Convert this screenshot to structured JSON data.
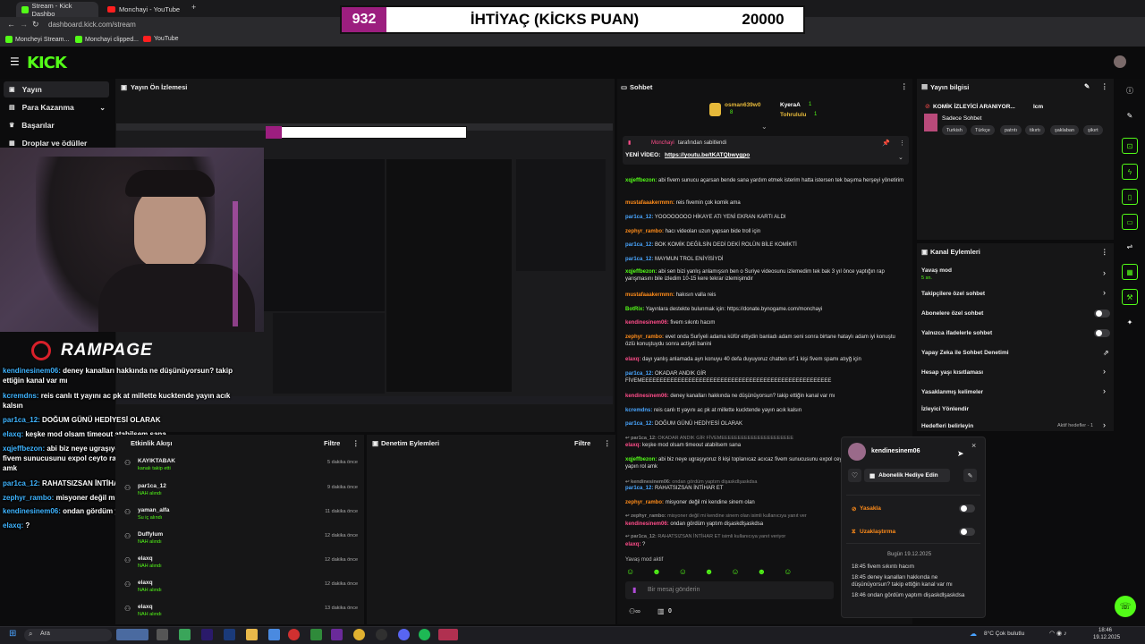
{
  "browser": {
    "tabs": [
      {
        "label": "Stream - Kick Dashbo"
      },
      {
        "label": "Monchayi - YouTube"
      }
    ],
    "url": "dashboard.kick.com/stream",
    "bookmarks": [
      {
        "label": "Moncheyi Stream..."
      },
      {
        "label": "Monchayi clipped..."
      },
      {
        "label": "YouTube"
      }
    ]
  },
  "overlay": {
    "count": "932",
    "title": "İHTİYAÇ (KİCKS PUAN)",
    "goal": "20000"
  },
  "sidebar": {
    "items": [
      {
        "label": "Yayın"
      },
      {
        "label": "Para Kazanma"
      },
      {
        "label": "Başarılar"
      },
      {
        "label": "Droplar ve ödüller"
      }
    ]
  },
  "preview": {
    "title": "Yayın Ön İzlemesi",
    "logo_text": "RAMPAGE"
  },
  "stream_chat_overlay": [
    {
      "user": "kendinesinem06:",
      "text": " deney kanalları hakkında ne düşünüyorsun? takip ettiğin kanal var mı"
    },
    {
      "user": "kcremdns:",
      "text": " reis canlı tt yayını ac pk at millette kucktende yayın acık kalsın"
    },
    {
      "user": "par1ca_12:",
      "text": " DOĞUM GÜNÜ HEDİYESİ OLARAK"
    },
    {
      "user": "elaxq:",
      "text": " keşke mod olsam timeout atabilsem sana"
    },
    {
      "user": "xqjeffbezon:",
      "text": " abi biz neye ugraşıyoruz 8 kişi toplanıcaz acıcaz fivem sunucusunu expol ceyto raconsal alıcaz hepsini yapın rol amk"
    },
    {
      "user": "par1ca_12:",
      "text": " RAHATSIZSAN İNTİHAR ET"
    },
    {
      "user": "zephyr_rambo:",
      "text": " misyoner değil mi kendine sinem olan"
    },
    {
      "user": "kendinesinem06:",
      "text": " ondan gördüm yaptım dişaskdlşaskdsa"
    },
    {
      "user": "elaxq:",
      "text": " ?"
    }
  ],
  "chat": {
    "title": "Sohbet",
    "top_gifters": [
      {
        "name": "osman639w0",
        "count": "8"
      },
      {
        "name": "KyeraA",
        "count": "1"
      },
      {
        "name": "Tohrululu",
        "count": "1"
      }
    ],
    "pinned": {
      "user": "Monchayi",
      "suffix": "tarafından sabitlendi",
      "label": "YENİ VİDEO:",
      "link": "https://youtu.be/tKATQbwygpo"
    },
    "messages": [
      {
        "user": "xqjeffbezon:",
        "text": "abi fivem sunucu açarsan bende sana yardım etmek isterim hatta istersen tek başıma herşeyi yönetirim",
        "color": "green"
      },
      {
        "user": "mustafaaakermmn:",
        "text": "reis fivemin çok komik ama",
        "color": "orange"
      },
      {
        "user": "par1ca_12:",
        "text": "YOOOOOOOO HİKAYE ATI YENİ EKRAN KARTI ALDI",
        "color": "blue"
      },
      {
        "user": "zephyr_rambo:",
        "text": "hacı videoları uzun yapsan bide troll için",
        "color": "orange"
      },
      {
        "user": "par1ca_12:",
        "text": "BOK KOMİK DEĞİLSİN DEDİ DEKİ ROLÜN BİLE KOMİKTİ",
        "color": "blue"
      },
      {
        "user": "par1ca_12:",
        "text": "MAYMUN TROL ENİYİSİYDİ",
        "color": "blue"
      },
      {
        "user": "xqjeffbezon:",
        "text": "abi sen bizi yanlış anlamışsın ben o Suriye videosunu izlemedim tek bak 3 yıl önce yaptığın rap yarışmasını bile izledim 10-15 kere tekrar izlemişimdir",
        "color": "green"
      },
      {
        "user": "mustafaaakermmn:",
        "text": "hakısın valla reis",
        "color": "orange"
      },
      {
        "user": "BotRix:",
        "text": "Yayınlara destekte bulunmak için: https://donate.bynogame.com/monchayi",
        "color": "green"
      },
      {
        "user": "kendinesinem06:",
        "text": "fivem sıkıntı hacım",
        "color": "pink"
      },
      {
        "user": "zephyr_rambo:",
        "text": "evet onda Surİyeli adama küfür ettiydin banladı adam seni sonra birtane hataylı adam iyi konuştu özlü konuştuydu sonra actiydi banini",
        "color": "orange"
      },
      {
        "user": "elaxq:",
        "text": "dayı yanlış anlamada ayrı konuyu 40 defa duyuyoruz chatten srf 1 kişi fivem spamı atıyğ için",
        "color": "pink"
      },
      {
        "user": "par1ca_12:",
        "text": "OKADAR ANDIK GİR FİVEMEEEEEEEEEEEEEEEEEEEEEEEEEEEEEEEEEEEEEEEEEEEEEEEEEEEEE",
        "color": "blue"
      },
      {
        "user": "kendinesinem06:",
        "text": "deney kanalları hakkında ne düşünüyorsun? takip ettiğin kanal var mı",
        "color": "pink"
      },
      {
        "user": "kcremdns:",
        "text": "reis canlı tt yayını ac pk at millette kucktende yayın acık kalsın",
        "color": "blue"
      },
      {
        "user": "par1ca_12:",
        "text": "DOĞUM GÜNÜ HEDİYESİ OLARAK",
        "color": "blue"
      },
      {
        "user": "↩ par1ca_12:",
        "text": "OKADAR ANDIK GİR FİVEMEEEEEEEEEEEEEEEEEEEEEE",
        "color": "grey"
      },
      {
        "user": "elaxq:",
        "text": "keşke mod olsam timeout atabilsem sana",
        "color": "pink"
      },
      {
        "user": "xqjeffbezon:",
        "text": "abi biz neye ugraşıyoruz 8 kişi toplanıcaz acıcaz fivem sunucusunu expol ceyto raconsal alıcaz hepsini yapın rol amk",
        "color": "green"
      },
      {
        "user": "↩ kendinesinem06:",
        "text": "ondan gördüm yaptım dişaskdlşaskdsa",
        "color": "grey"
      },
      {
        "user": "par1ca_12:",
        "text": "RAHATSIZSAN İNTİHAR ET",
        "color": "blue"
      },
      {
        "user": "zephyr_rambo:",
        "text": "misyoner değil mi kendine sinem olan",
        "color": "orange"
      },
      {
        "user": "↩ zephyr_rambo:",
        "text": "misyoner değil mi kendine sinem olan isimli kullanıcıya yanıt ver",
        "color": "grey"
      },
      {
        "user": "kendinesinem06:",
        "text": "ondan gördüm yaptım dişaskdlşaskdsa",
        "color": "pink"
      },
      {
        "user": "↩ par1ca_12:",
        "text": "RAHATSIZSAN İNTİHAR ET isimli kullanıcıya yanıt veriyor",
        "color": "grey"
      },
      {
        "user": "elaxq:",
        "text": "?",
        "color": "pink"
      }
    ],
    "slow_mode": "Yavaş mod aktif",
    "input_placeholder": "Bir mesaj gönderin",
    "footer_count": "0"
  },
  "stream_info": {
    "title": "Yayın bilgisi",
    "stream_title": "KOMİK İZLEYİCİ ARANIYOR...",
    "stream_title_suffix": "lcm",
    "category": "Sadece Sohbet",
    "tags": [
      "Turkish",
      "Türkçe",
      "patrıtı",
      "tikırtı",
      "şaklaban",
      "şikırt"
    ]
  },
  "channel_actions": {
    "title": "Kanal Eylemleri",
    "items": [
      {
        "label": "Yavaş mod",
        "sub": "5 sn."
      },
      {
        "label": "Takipçilere özel sohbet"
      },
      {
        "label": "Abonelere özel sohbet"
      },
      {
        "label": "Yalnızca ifadelerle sohbet"
      },
      {
        "label": "Yapay Zeka ile Sohbet Denetimi"
      },
      {
        "label": "Hesap yaşı kısıtlaması"
      },
      {
        "label": "Yasaklanmış kelimeler"
      },
      {
        "label": "İzleyici Yönlendir"
      },
      {
        "label": "Hedefleri belirleyin",
        "sub": "Aktif hedefler - 1"
      }
    ]
  },
  "activity": {
    "title": "Etkinlik Akışı",
    "filter": "Filtre",
    "items": [
      {
        "user": "KAYIKTABAK",
        "desc": "kanalı takip etti",
        "time": "5 dakika önce"
      },
      {
        "user": "par1ca_12",
        "desc": "NAH alındı",
        "time": "9 dakika önce"
      },
      {
        "user": "yaman_alfa",
        "desc": "Su iç alındı",
        "time": "11 dakika önce"
      },
      {
        "user": "Duffylum",
        "desc": "NAH alındı",
        "time": "12 dakika önce"
      },
      {
        "user": "elaxq",
        "desc": "NAH alındı",
        "time": "12 dakika önce"
      },
      {
        "user": "elaxq",
        "desc": "NAH alındı",
        "time": "12 dakika önce"
      },
      {
        "user": "elaxq",
        "desc": "NAH alındı",
        "time": "13 dakika önce"
      }
    ]
  },
  "mod_log": {
    "title": "Denetim Eylemleri",
    "filter": "Filtre"
  },
  "user_card": {
    "username": "kendinesinem06",
    "gift_button": "Abonelik Hediye Edin",
    "ban_label": "Yasakla",
    "timeout_label": "Uzaklaştırma",
    "date_label": "Bugün 19.12.2025",
    "history": [
      {
        "time": "18:45",
        "text": "fivem sıkıntı hacım"
      },
      {
        "time": "18:45",
        "text": "deney kanalları hakkında ne düşünüyorsun? takip ettiğin kanal var mı"
      },
      {
        "time": "18:46",
        "text": "ondan gördüm yaptım dişaskdlşaskdsa"
      }
    ]
  },
  "taskbar": {
    "search_placeholder": "Ara",
    "weather": "8°C  Çok bulutlu",
    "time": "18:46",
    "date": "19.12.2025"
  },
  "colors": {
    "kick_green": "#53fc18",
    "overlay_count_bg": "#9c1e7f",
    "chat_blue": "#49a6ff",
    "chat_orange": "#ff8c1a",
    "chat_pink": "#ff4d8a"
  }
}
